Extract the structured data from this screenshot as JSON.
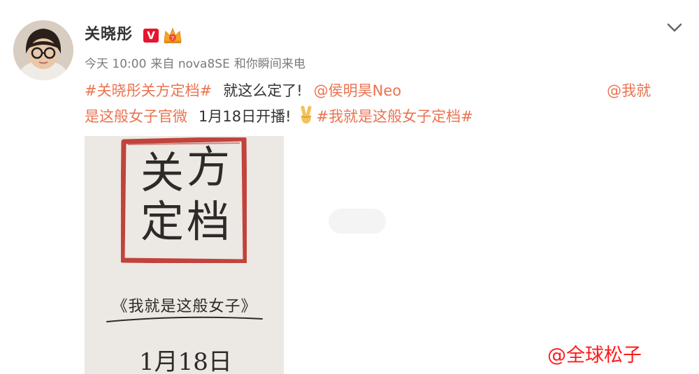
{
  "user": {
    "name": "关晓彤",
    "verified_mark": "V"
  },
  "post_meta": {
    "time": "今天 10:00",
    "source_prefix": "来自",
    "device": "nova8SE",
    "device_tagline": "和你瞬间来电"
  },
  "post": {
    "hashtag_1": "#关晓彤关方定档#",
    "text_1": "就这么定了!",
    "mention_1": "@侯明昊Neo",
    "mention_2_a": "@我就",
    "mention_2_b": "是这般女子官微",
    "text_2": "1月18日开播!",
    "hashtag_2": "#我就是这般女子定档#"
  },
  "poster": {
    "title_1": "关",
    "title_2": "方",
    "title_3": "定",
    "title_4": "档",
    "show_title": "《我就是这般女子》",
    "date": "1月18日"
  },
  "watermark": "@全球松子",
  "colors": {
    "link": "#eb7350",
    "badge": "#e6162d",
    "crown": "#f5a623",
    "stamp_red": "#b8261f",
    "watermark": "#ff1a1a"
  }
}
